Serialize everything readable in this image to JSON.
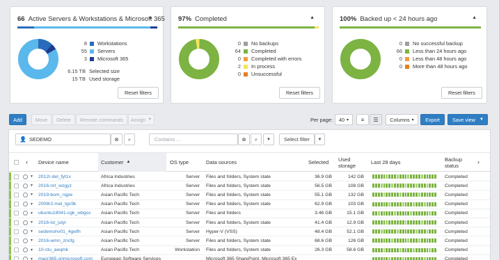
{
  "colors": {
    "accent": "#2f7ec4",
    "light_blue": "#5ab8ec",
    "navy": "#1d3c8f",
    "green": "#7cb342",
    "yellow": "#f4e55e",
    "orange": "#f39c3c",
    "light_orange": "#f6c17a",
    "gray": "#9e9e9e"
  },
  "cards": {
    "servers": {
      "count": "66",
      "title": "Active Servers & Workstations & Microsoft 365",
      "legend": [
        {
          "num": "8",
          "label": "Workstations",
          "color": "#2a6bbd"
        },
        {
          "num": "55",
          "label": "Servers",
          "color": "#5ab8ec"
        },
        {
          "num": "3",
          "label": "Microsoft 365",
          "color": "#1d3c8f"
        }
      ],
      "selected_size": "6.15 TB",
      "selected_label": "Selected size",
      "used_storage": "15 TB",
      "used_label": "Used storage",
      "reset": "Reset filters"
    },
    "completed": {
      "percent": "97%",
      "title": "Completed",
      "legend": [
        {
          "num": "0",
          "label": "No backups",
          "color": "#9e9e9e"
        },
        {
          "num": "64",
          "label": "Completed",
          "color": "#7cb342"
        },
        {
          "num": "0",
          "label": "Completed with errors",
          "color": "#f39c3c"
        },
        {
          "num": "2",
          "label": "In process",
          "color": "#f4e55e"
        },
        {
          "num": "0",
          "label": "Unsuccessful",
          "color": "#e67e22"
        }
      ],
      "reset": "Reset filters"
    },
    "backedup": {
      "percent": "100%",
      "title": "Backed up < 24 hours ago",
      "legend": [
        {
          "num": "0",
          "label": "No successful backup",
          "color": "#9e9e9e"
        },
        {
          "num": "66",
          "label": "Less than 24 hours ago",
          "color": "#7cb342"
        },
        {
          "num": "0",
          "label": "Less than 48 hours ago",
          "color": "#f39c3c"
        },
        {
          "num": "0",
          "label": "More than 48 hours ago",
          "color": "#e67e22"
        }
      ],
      "reset": "Reset filters"
    }
  },
  "toolbar": {
    "add": "Add",
    "move": "Move",
    "delete": "Delete",
    "remote": "Remote commands",
    "assign": "Assign",
    "per_page_label": "Per page:",
    "per_page_value": "40",
    "columns": "Columns",
    "export": "Export",
    "save_view": "Save view"
  },
  "filters": {
    "customer_value": "SEDEMO",
    "contains_placeholder": "Contains ...",
    "select_filter": "Select filter"
  },
  "table": {
    "headers": {
      "device": "Device name",
      "customer": "Customer",
      "os": "OS type",
      "sources": "Data sources",
      "selected": "Selected",
      "used": "Used storage",
      "last28": "Last 28 days",
      "status": "Backup status"
    },
    "rows": [
      {
        "device": "2012r-del_fyt1x",
        "customer": "Africa Industries",
        "os": "Server",
        "sources": "Files and folders, System state",
        "selected": "36.9 GB",
        "used": "142 GB",
        "status": "Completed"
      },
      {
        "device": "2016-nrt_wzgyz",
        "customer": "Africa Industries",
        "os": "Server",
        "sources": "Files and folders, System state",
        "selected": "56.5 GB",
        "used": "108 GB",
        "status": "Completed"
      },
      {
        "device": "2019-bom_rsjpe",
        "customer": "Asian Pacific Tech",
        "os": "Server",
        "sources": "Files and folders, System state",
        "selected": "55.1 GB",
        "used": "132 GB",
        "status": "Completed"
      },
      {
        "device": "2008r2-mel_tgc9k",
        "customer": "Asian Pacific Tech",
        "os": "Server",
        "sources": "Files and folders, System state",
        "selected": "62.9 GB",
        "used": "103 GB",
        "status": "Completed"
      },
      {
        "device": "ubuntu18041-cgk_wbgss",
        "customer": "Asian Pacific Tech",
        "os": "Server",
        "sources": "Files and folders",
        "selected": "3.46 GB",
        "used": "15.1 GB",
        "status": "Completed"
      },
      {
        "device": "2016-lst_julyi",
        "customer": "Asian Pacific Tech",
        "os": "Server",
        "sources": "Files and folders, System state",
        "selected": "41.4 GB",
        "used": "12.9 GB",
        "status": "Completed"
      },
      {
        "device": "sedemohv01_4gwfh",
        "customer": "Asian Pacific Tech",
        "os": "Server",
        "sources": "Hyper-V (VSS)",
        "selected": "48.4 GB",
        "used": "52.1 GB",
        "status": "Completed"
      },
      {
        "device": "2016-wmn_zncfg",
        "customer": "Asian Pacific Tech",
        "os": "Server",
        "sources": "Files and folders, System state",
        "selected": "68.6 GB",
        "used": "126 GB",
        "status": "Completed"
      },
      {
        "device": "10-ctu_aeqmk",
        "customer": "Asian Pacific Tech",
        "os": "Workstation",
        "sources": "Files and folders, System state",
        "selected": "26.3 GB",
        "used": "58.6 GB",
        "status": "Completed"
      },
      {
        "device": "macr365.onmicrosoft.com",
        "customer": "European Software Services",
        "os": "",
        "sources": "Microsoft 365 SharePoint, Microsoft 365 Exc...",
        "selected": "",
        "used": "",
        "status": "Completed"
      }
    ]
  }
}
